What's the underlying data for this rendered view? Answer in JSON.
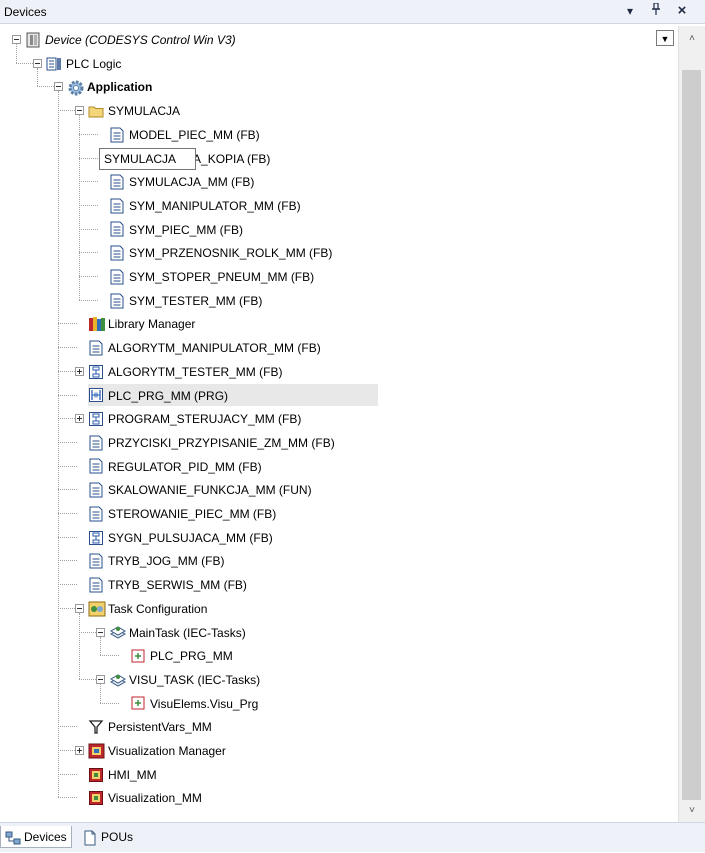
{
  "panel": {
    "title": "Devices",
    "dropdown_glyph": "▾",
    "pin_glyph": "ᵖ",
    "close_glyph": "×",
    "top_dropdown_glyph": "▼",
    "scroll_up": "˄",
    "scroll_down": "˅"
  },
  "tooltip": "SYMULACJA",
  "tree": [
    {
      "label": "Device (CODESYS Control Win V3)",
      "icon": "device-icon",
      "depth": 1,
      "expander": "minus",
      "italic": true
    },
    {
      "label": "PLC Logic",
      "icon": "plc-logic-icon",
      "depth": 2,
      "expander": "minus"
    },
    {
      "label": "Application",
      "icon": "application-gear-icon",
      "depth": 3,
      "expander": "minus",
      "bold": true
    },
    {
      "label": "SYMULACJA",
      "icon": "folder-icon",
      "depth": 4,
      "expander": "minus"
    },
    {
      "label": "MODEL_PIEC_MM (FB)",
      "icon": "pou-st-icon",
      "depth": 5
    },
    {
      "label": "SYMULACJA_KOPIA (FB)",
      "icon": "pou-st-icon",
      "depth": 5
    },
    {
      "label": "SYMULACJA_MM (FB)",
      "icon": "pou-st-icon",
      "depth": 5
    },
    {
      "label": "SYM_MANIPULATOR_MM (FB)",
      "icon": "pou-st-icon",
      "depth": 5
    },
    {
      "label": "SYM_PIEC_MM (FB)",
      "icon": "pou-st-icon",
      "depth": 5
    },
    {
      "label": "SYM_PRZENOSNIK_ROLK_MM (FB)",
      "icon": "pou-st-icon",
      "depth": 5
    },
    {
      "label": "SYM_STOPER_PNEUM_MM (FB)",
      "icon": "pou-st-icon",
      "depth": 5
    },
    {
      "label": "SYM_TESTER_MM (FB)",
      "icon": "pou-st-icon",
      "depth": 5
    },
    {
      "label": "Library Manager",
      "icon": "library-books-icon",
      "depth": 4
    },
    {
      "label": "ALGORYTM_MANIPULATOR_MM (FB)",
      "icon": "pou-st-icon",
      "depth": 4
    },
    {
      "label": "ALGORYTM_TESTER_MM (FB)",
      "icon": "pou-sfc-icon",
      "depth": 4,
      "expander": "plus"
    },
    {
      "label": "PLC_PRG_MM (PRG)",
      "icon": "pou-ld-icon",
      "depth": 4,
      "selected": true
    },
    {
      "label": "PROGRAM_STERUJACY_MM (FB)",
      "icon": "pou-sfc-icon",
      "depth": 4,
      "expander": "plus"
    },
    {
      "label": "PRZYCISKI_PRZYPISANIE_ZM_MM (FB)",
      "icon": "pou-st-icon",
      "depth": 4
    },
    {
      "label": "REGULATOR_PID_MM (FB)",
      "icon": "pou-st-icon",
      "depth": 4
    },
    {
      "label": "SKALOWANIE_FUNKCJA_MM (FUN)",
      "icon": "pou-st-icon",
      "depth": 4
    },
    {
      "label": "STEROWANIE_PIEC_MM (FB)",
      "icon": "pou-st-icon",
      "depth": 4
    },
    {
      "label": "SYGN_PULSUJACA_MM (FB)",
      "icon": "pou-sfc-icon",
      "depth": 4
    },
    {
      "label": "TRYB_JOG_MM (FB)",
      "icon": "pou-st-icon",
      "depth": 4
    },
    {
      "label": "TRYB_SERWIS_MM (FB)",
      "icon": "pou-st-icon",
      "depth": 4
    },
    {
      "label": "Task Configuration",
      "icon": "task-configuration-icon",
      "depth": 4,
      "expander": "minus"
    },
    {
      "label": "MainTask (IEC-Tasks)",
      "icon": "task-icon",
      "depth": 5,
      "expander": "minus"
    },
    {
      "label": "PLC_PRG_MM",
      "icon": "program-call-icon",
      "depth": 6
    },
    {
      "label": "VISU_TASK (IEC-Tasks)",
      "icon": "task-icon",
      "depth": 5,
      "expander": "minus"
    },
    {
      "label": "VisuElems.Visu_Prg",
      "icon": "program-call-icon",
      "depth": 6
    },
    {
      "label": "PersistentVars_MM",
      "icon": "persistent-vars-icon",
      "depth": 4
    },
    {
      "label": "Visualization Manager",
      "icon": "visualization-manager-icon",
      "depth": 4,
      "expander": "plus"
    },
    {
      "label": "HMI_MM",
      "icon": "visualization-icon",
      "depth": 4
    },
    {
      "label": "Visualization_MM",
      "icon": "visualization-icon",
      "depth": 4
    }
  ],
  "tabs": [
    {
      "label": "Devices",
      "icon": "devices-tab-icon",
      "active": true
    },
    {
      "label": "POUs",
      "icon": "pous-tab-icon",
      "active": false
    }
  ],
  "colors": {
    "selection": "#e8e8e8",
    "folder": "#e8c55a",
    "gear": "#7fa7cf",
    "sfc_blue": "#2a5db0",
    "visu_red": "#c0272d",
    "task_green": "#3e8e3e"
  }
}
